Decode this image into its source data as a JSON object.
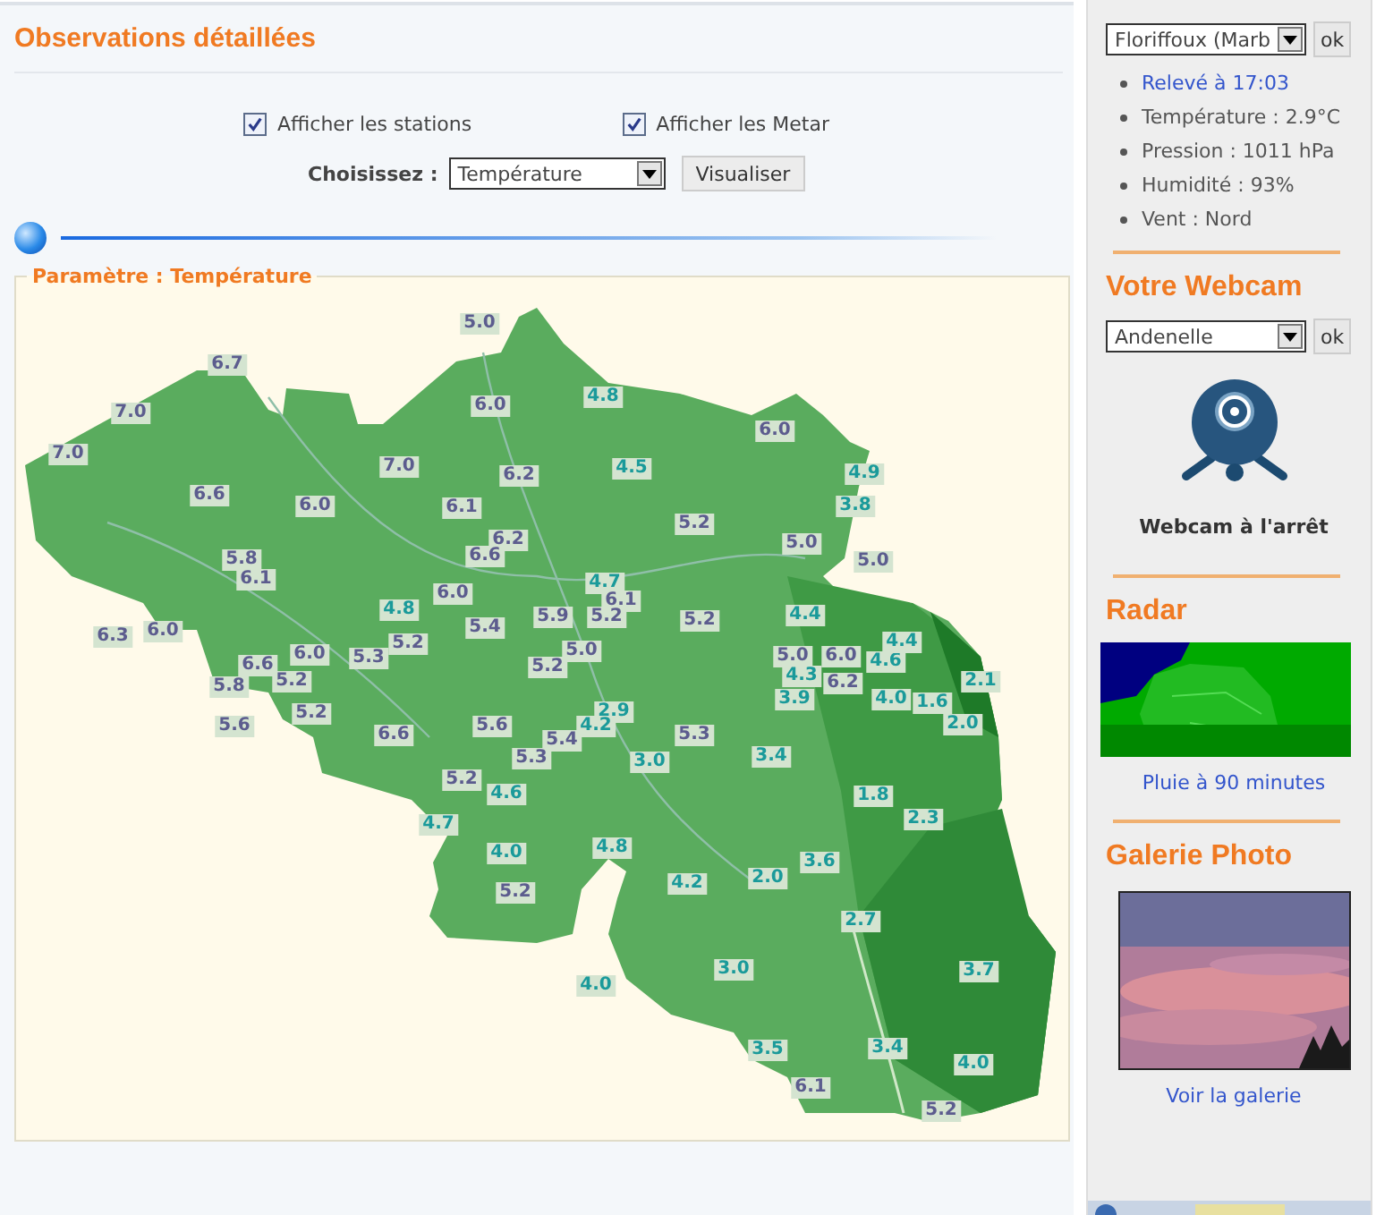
{
  "header": {
    "title": "Observations détaillées"
  },
  "options": [
    {
      "label": "Afficher les stations",
      "checked": true
    },
    {
      "label": "Afficher les Metar",
      "checked": true
    }
  ],
  "parameter_select": {
    "label": "Choisissez :",
    "value": "Température",
    "button": "Visualiser"
  },
  "timeline": {
    "level": 0
  },
  "map": {
    "legend": "Paramètre : Température",
    "readings": [
      {
        "value": "5.0",
        "color": "#5c5c8e"
      },
      {
        "value": "6.7",
        "color": "#5c5c8e"
      },
      {
        "value": "7.0",
        "color": "#5c5c8e"
      },
      {
        "value": "6.0",
        "color": "#5c5c8e"
      },
      {
        "value": "4.8",
        "color": "#1a9a9a"
      },
      {
        "value": "6.0",
        "color": "#5c5c8e"
      },
      {
        "value": "7.0",
        "color": "#5c5c8e"
      },
      {
        "value": "7.0",
        "color": "#5c5c8e"
      },
      {
        "value": "6.2",
        "color": "#5c5c8e"
      },
      {
        "value": "4.5",
        "color": "#1a9a9a"
      },
      {
        "value": "4.9",
        "color": "#1a9a9a"
      },
      {
        "value": "6.6",
        "color": "#5c5c8e"
      },
      {
        "value": "6.0",
        "color": "#5c5c8e"
      },
      {
        "value": "6.1",
        "color": "#5c5c8e"
      },
      {
        "value": "3.8",
        "color": "#1a9a9a"
      },
      {
        "value": "5.2",
        "color": "#5c5c8e"
      },
      {
        "value": "6.2",
        "color": "#5c5c8e"
      },
      {
        "value": "5.0",
        "color": "#5c5c8e"
      },
      {
        "value": "5.8",
        "color": "#5c5c8e"
      },
      {
        "value": "6.6",
        "color": "#5c5c8e"
      },
      {
        "value": "5.0",
        "color": "#5c5c8e"
      },
      {
        "value": "6.1",
        "color": "#5c5c8e"
      },
      {
        "value": "4.8",
        "color": "#1a9a9a"
      },
      {
        "value": "6.0",
        "color": "#5c5c8e"
      },
      {
        "value": "4.7",
        "color": "#1a9a9a"
      },
      {
        "value": "6.1",
        "color": "#5c5c8e"
      },
      {
        "value": "6.3",
        "color": "#5c5c8e"
      },
      {
        "value": "6.0",
        "color": "#5c5c8e"
      },
      {
        "value": "5.4",
        "color": "#5c5c8e"
      },
      {
        "value": "5.9",
        "color": "#5c5c8e"
      },
      {
        "value": "5.2",
        "color": "#5c5c8e"
      },
      {
        "value": "5.2",
        "color": "#5c5c8e"
      },
      {
        "value": "4.4",
        "color": "#1a9a9a"
      },
      {
        "value": "6.6",
        "color": "#5c5c8e"
      },
      {
        "value": "6.0",
        "color": "#5c5c8e"
      },
      {
        "value": "5.3",
        "color": "#5c5c8e"
      },
      {
        "value": "5.2",
        "color": "#5c5c8e"
      },
      {
        "value": "5.2",
        "color": "#5c5c8e"
      },
      {
        "value": "5.0",
        "color": "#5c5c8e"
      },
      {
        "value": "5.0",
        "color": "#5c5c8e"
      },
      {
        "value": "6.0",
        "color": "#5c5c8e"
      },
      {
        "value": "4.6",
        "color": "#1a9a9a"
      },
      {
        "value": "4.4",
        "color": "#1a9a9a"
      },
      {
        "value": "5.8",
        "color": "#5c5c8e"
      },
      {
        "value": "5.2",
        "color": "#5c5c8e"
      },
      {
        "value": "4.3",
        "color": "#1a9a9a"
      },
      {
        "value": "6.2",
        "color": "#5c5c8e"
      },
      {
        "value": "2.1",
        "color": "#1a9a9a"
      },
      {
        "value": "5.2",
        "color": "#5c5c8e"
      },
      {
        "value": "2.9",
        "color": "#1a9a9a"
      },
      {
        "value": "3.9",
        "color": "#1a9a9a"
      },
      {
        "value": "4.0",
        "color": "#1a9a9a"
      },
      {
        "value": "1.6",
        "color": "#1a9a9a"
      },
      {
        "value": "5.6",
        "color": "#5c5c8e"
      },
      {
        "value": "6.6",
        "color": "#5c5c8e"
      },
      {
        "value": "5.6",
        "color": "#5c5c8e"
      },
      {
        "value": "5.4",
        "color": "#5c5c8e"
      },
      {
        "value": "4.2",
        "color": "#1a9a9a"
      },
      {
        "value": "5.3",
        "color": "#5c5c8e"
      },
      {
        "value": "2.0",
        "color": "#1a9a9a"
      },
      {
        "value": "5.3",
        "color": "#5c5c8e"
      },
      {
        "value": "3.0",
        "color": "#1a9a9a"
      },
      {
        "value": "3.4",
        "color": "#1a9a9a"
      },
      {
        "value": "5.2",
        "color": "#5c5c8e"
      },
      {
        "value": "4.6",
        "color": "#1a9a9a"
      },
      {
        "value": "1.8",
        "color": "#1a9a9a"
      },
      {
        "value": "4.7",
        "color": "#1a9a9a"
      },
      {
        "value": "2.3",
        "color": "#1a9a9a"
      },
      {
        "value": "4.0",
        "color": "#1a9a9a"
      },
      {
        "value": "4.8",
        "color": "#1a9a9a"
      },
      {
        "value": "3.6",
        "color": "#1a9a9a"
      },
      {
        "value": "5.2",
        "color": "#5c5c8e"
      },
      {
        "value": "4.2",
        "color": "#1a9a9a"
      },
      {
        "value": "2.0",
        "color": "#1a9a9a"
      },
      {
        "value": "2.7",
        "color": "#1a9a9a"
      },
      {
        "value": "4.0",
        "color": "#1a9a9a"
      },
      {
        "value": "3.0",
        "color": "#1a9a9a"
      },
      {
        "value": "3.7",
        "color": "#1a9a9a"
      },
      {
        "value": "3.5",
        "color": "#1a9a9a"
      },
      {
        "value": "3.4",
        "color": "#1a9a9a"
      },
      {
        "value": "4.0",
        "color": "#1a9a9a"
      },
      {
        "value": "6.1",
        "color": "#5c5c8e"
      },
      {
        "value": "5.2",
        "color": "#5c5c8e"
      }
    ]
  },
  "sidebar": {
    "station_select": {
      "value": "Floriffoux (Marb",
      "button": "ok"
    },
    "observations": [
      {
        "text": "Relevé à 17:03",
        "kind": "link"
      },
      {
        "text": "Température : 2.9°C",
        "kind": "plain"
      },
      {
        "text": "Pression : 1011 hPa",
        "kind": "plain"
      },
      {
        "text": "Humidité : 93%",
        "kind": "plain"
      },
      {
        "text": "Vent : Nord",
        "kind": "plain"
      }
    ],
    "webcam": {
      "title": "Votre Webcam",
      "select": "Andenelle",
      "button": "ok",
      "status": "Webcam à l'arrêt"
    },
    "radar": {
      "title": "Radar",
      "link": "Pluie à 90 minutes"
    },
    "gallery": {
      "title": "Galerie Photo",
      "link": "Voir la galerie"
    }
  }
}
